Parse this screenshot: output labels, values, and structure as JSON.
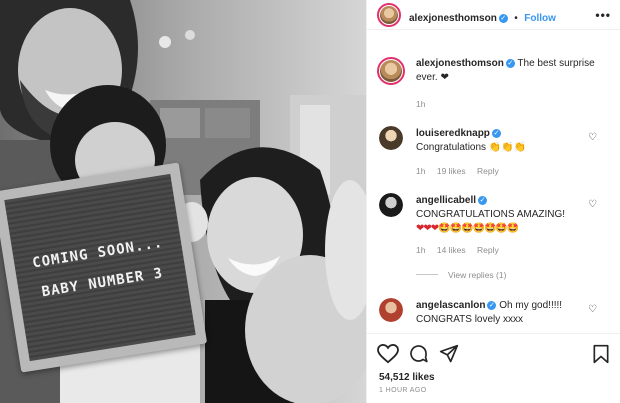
{
  "photo": {
    "alt_subject": "selfie",
    "letterboard_lines": [
      "COMING SOON...",
      "BABY NUMBER 3"
    ]
  },
  "header": {
    "username": "alexjonesthomson",
    "separator": "•",
    "follow_label": "Follow",
    "more_label": "•••"
  },
  "caption": {
    "username": "alexjonesthomson",
    "text": "The best surprise ever. ❤",
    "time": "1h"
  },
  "comments": [
    {
      "username": "louiseredknapp",
      "text": "Congratulations 👏👏👏",
      "time": "1h",
      "likes": "19 likes",
      "reply": "Reply"
    },
    {
      "username": "angellicabell",
      "text": "CONGRATULATIONS AMAZING!",
      "emoji_line": "❤❤❤🤩🤩🤩🤩🤩🤩🤩",
      "time": "1h",
      "likes": "14 likes",
      "reply": "Reply",
      "view_replies": "View replies (1)"
    },
    {
      "username": "angelascanlon",
      "text": "Oh my god!!!!!",
      "text2": "CONGRATS lovely xxxx"
    }
  ],
  "footer": {
    "likes": "54,512 likes",
    "timestamp": "1 HOUR AGO"
  },
  "colors": {
    "link": "#3897f0",
    "muted": "#8e8e8e",
    "story_ring": "#e1306c"
  },
  "icons": [
    "heart-icon",
    "comment-icon",
    "share-icon",
    "bookmark-icon",
    "verified-icon",
    "more-icon"
  ]
}
